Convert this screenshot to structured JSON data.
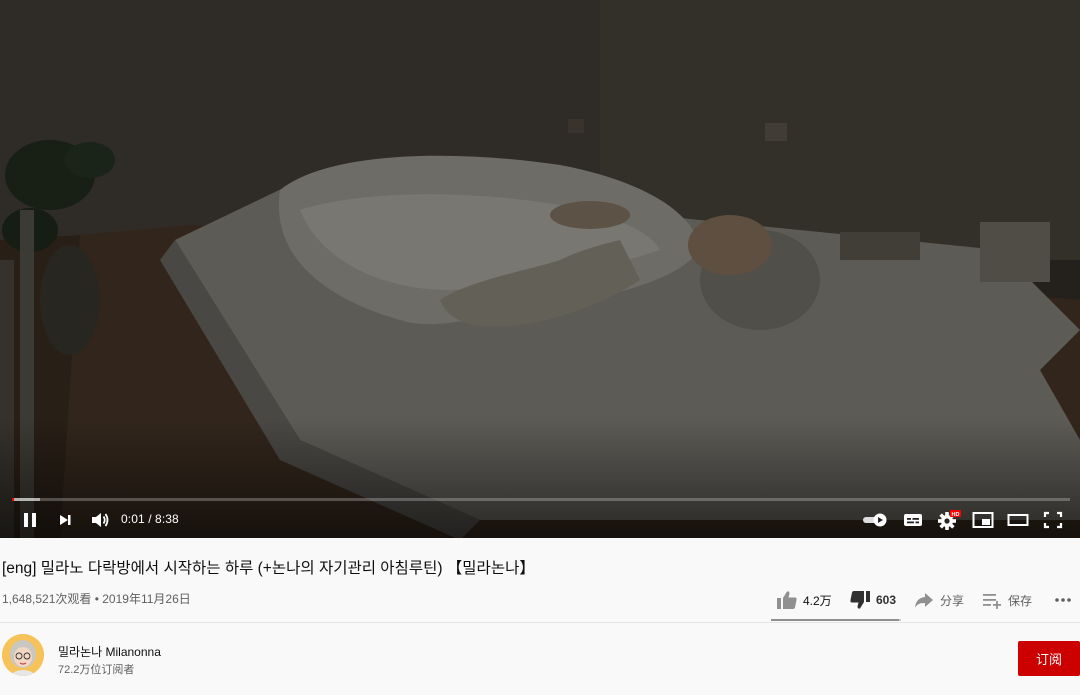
{
  "player": {
    "current_time": "0:01",
    "duration": "8:38",
    "time_display": "0:01 / 8:38",
    "progress_fraction": 0.002,
    "buffered_fraction": 0.026,
    "hd_badge": "HD"
  },
  "video": {
    "title": "[eng] 밀라노 다락방에서 시작하는 하루 (+논나의 자기관리 아침루틴) 【밀라논나】",
    "meta": "1,648,521次观看 • 2019年11月26日"
  },
  "actions": {
    "likes": "4.2万",
    "dislikes": "603",
    "share_label": "分享",
    "save_label": "保存",
    "like_fraction": 0.985
  },
  "channel": {
    "name": "밀라논나 Milanonna",
    "subscribers": "72.2万位订阅者",
    "subscribe_label": "订阅"
  },
  "colors": {
    "subscribe_bg": "#cc0000",
    "progress_played": "#ff0000",
    "hd_badge": "#ff0000"
  },
  "icons": [
    "pause-icon",
    "next-icon",
    "volume-icon",
    "autoplay-toggle-icon",
    "subtitles-icon",
    "settings-icon",
    "miniplayer-icon",
    "theater-mode-icon",
    "fullscreen-icon",
    "thumbs-up-icon",
    "thumbs-down-icon",
    "share-icon",
    "save-playlist-icon",
    "more-icon"
  ]
}
